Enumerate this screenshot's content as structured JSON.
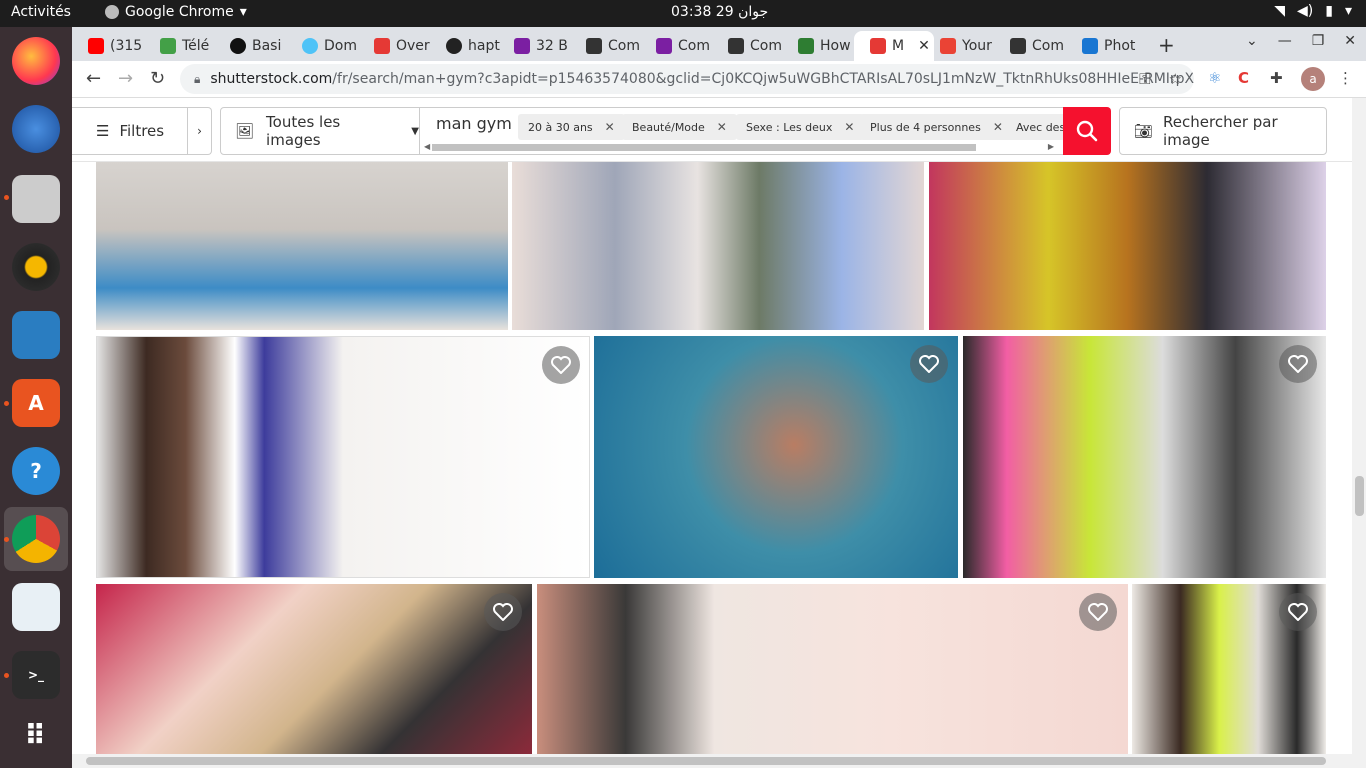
{
  "system": {
    "activities": "Activités",
    "app_name": "Google Chrome",
    "clock": "03:38 جوان 29"
  },
  "tabs": [
    {
      "label": "(315",
      "color": "#ff0000"
    },
    {
      "label": "Télé",
      "color": "#43a047"
    },
    {
      "label": "Basi",
      "color": "#111111"
    },
    {
      "label": "Dom",
      "color": "#4fc3f7"
    },
    {
      "label": "Over",
      "color": "#e53935"
    },
    {
      "label": "hapt",
      "color": "#222222"
    },
    {
      "label": "32 B",
      "color": "#7b1fa2"
    },
    {
      "label": "Com",
      "color": "#333333"
    },
    {
      "label": "Com",
      "color": "#7b1fa2"
    },
    {
      "label": "Com",
      "color": "#333333"
    },
    {
      "label": "How",
      "color": "#2e7d32"
    },
    {
      "label": "M",
      "color": "#e53935"
    },
    {
      "label": "Your",
      "color": "#ea4335"
    },
    {
      "label": "Com",
      "color": "#333333"
    },
    {
      "label": "Phot",
      "color": "#1976d2"
    }
  ],
  "address": {
    "domain": "shutterstock.com",
    "path": "/fr/search/man+gym?c3apidt=p15463574080&gclid=Cj0KCQjw5uWGBhCTARIsAL70sLJ1mNzW_TktnRhUks08HHIeE-RMIrpX..."
  },
  "profile_initial": "a",
  "search": {
    "filters_label": "Filtres",
    "image_type": "Toutes les images",
    "query": "man gym",
    "chips": [
      "20 à 30 ans",
      "Beauté/Mode",
      "Sexe : Les deux",
      "Plus de 4 personnes",
      "Avec des"
    ],
    "image_search_label": "Rechercher par image"
  },
  "colors": {
    "accent": "#f5112e"
  }
}
